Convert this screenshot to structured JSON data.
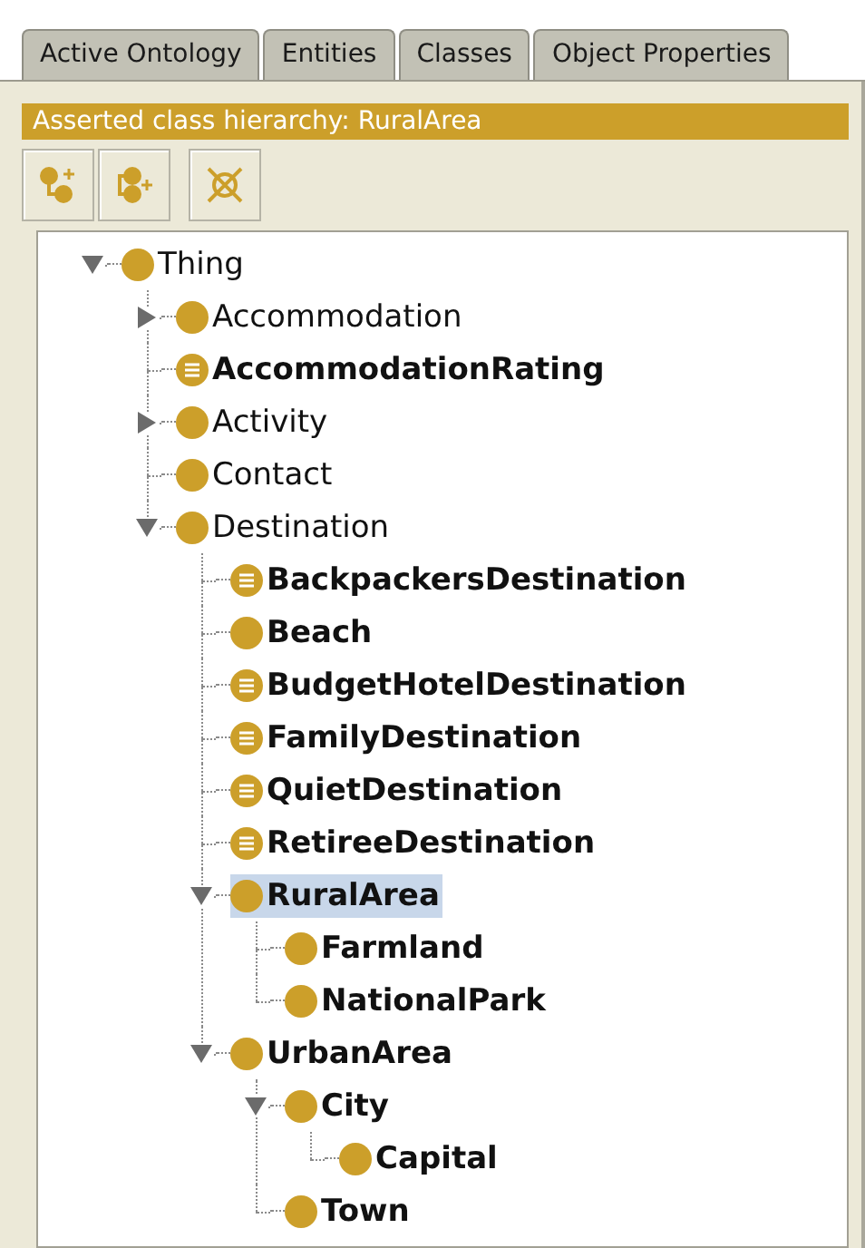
{
  "tabs": [
    {
      "label": "Active Ontology",
      "selected": false
    },
    {
      "label": "Entities",
      "selected": false
    },
    {
      "label": "Classes",
      "selected": false
    },
    {
      "label": "Object Properties",
      "selected": false
    }
  ],
  "view": {
    "title": "Asserted class hierarchy: RuralArea"
  },
  "tree": [
    {
      "label": "Thing",
      "kind": "primitive",
      "bold": false,
      "selected": false,
      "expanded": true,
      "children": [
        {
          "label": "Accommodation",
          "kind": "primitive",
          "bold": false,
          "selected": false,
          "expanded": false
        },
        {
          "label": "AccommodationRating",
          "kind": "defined",
          "bold": true,
          "selected": false
        },
        {
          "label": "Activity",
          "kind": "primitive",
          "bold": false,
          "selected": false,
          "expanded": false
        },
        {
          "label": "Contact",
          "kind": "primitive",
          "bold": false,
          "selected": false
        },
        {
          "label": "Destination",
          "kind": "primitive",
          "bold": false,
          "selected": false,
          "expanded": true,
          "children": [
            {
              "label": "BackpackersDestination",
              "kind": "defined",
              "bold": true,
              "selected": false
            },
            {
              "label": "Beach",
              "kind": "primitive",
              "bold": true,
              "selected": false
            },
            {
              "label": "BudgetHotelDestination",
              "kind": "defined",
              "bold": true,
              "selected": false
            },
            {
              "label": "FamilyDestination",
              "kind": "defined",
              "bold": true,
              "selected": false
            },
            {
              "label": "QuietDestination",
              "kind": "defined",
              "bold": true,
              "selected": false
            },
            {
              "label": "RetireeDestination",
              "kind": "defined",
              "bold": true,
              "selected": false
            },
            {
              "label": "RuralArea",
              "kind": "primitive",
              "bold": true,
              "selected": true,
              "expanded": true,
              "children": [
                {
                  "label": "Farmland",
                  "kind": "primitive",
                  "bold": true,
                  "selected": false
                },
                {
                  "label": "NationalPark",
                  "kind": "primitive",
                  "bold": true,
                  "selected": false
                }
              ]
            },
            {
              "label": "UrbanArea",
              "kind": "primitive",
              "bold": true,
              "selected": false,
              "expanded": true,
              "children": [
                {
                  "label": "City",
                  "kind": "primitive",
                  "bold": true,
                  "selected": false,
                  "expanded": true,
                  "children": [
                    {
                      "label": "Capital",
                      "kind": "primitive",
                      "bold": true,
                      "selected": false
                    }
                  ]
                },
                {
                  "label": "Town",
                  "kind": "primitive",
                  "bold": true,
                  "selected": false
                }
              ]
            }
          ]
        }
      ]
    }
  ]
}
